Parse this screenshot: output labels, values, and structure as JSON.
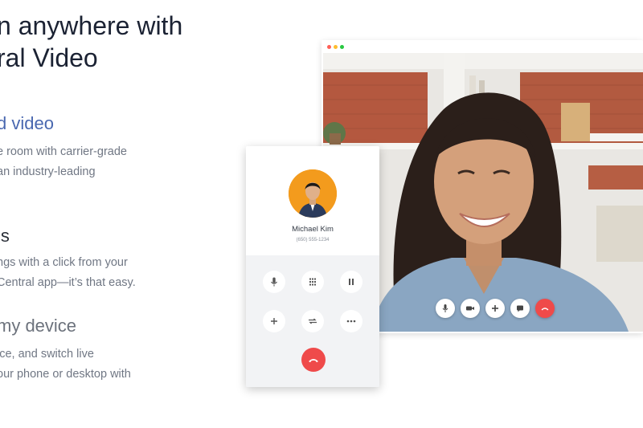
{
  "hero": {
    "title_line1": "n anywhere with",
    "title_line2": "ral Video"
  },
  "features": [
    {
      "title": "d video",
      "lines": [
        "e room with carrier-grade",
        "an industry-leading"
      ],
      "title_color": "#4a68b0"
    },
    {
      "title": "ls",
      "lines": [
        "ngs with a click from your",
        "Central app—it’s that easy."
      ],
      "title_color": "#2a2f38"
    },
    {
      "title": "my device",
      "lines": [
        "ice, and switch live",
        "our phone or desktop with"
      ],
      "title_color": "#6c727c"
    }
  ],
  "video_window": {
    "traffic_lights": [
      "#ff5f57",
      "#febc2e",
      "#28c840"
    ],
    "controls": [
      "microphone",
      "camera",
      "add",
      "chat",
      "end-call"
    ]
  },
  "call_card": {
    "caller_name": "Michael Kim",
    "caller_number": "(650) 555-1234",
    "buttons": [
      "microphone",
      "keypad",
      "pause",
      "add",
      "transfer",
      "more"
    ],
    "end_call_color": "#ef4a4a",
    "avatar_color": "#f39b1d"
  }
}
